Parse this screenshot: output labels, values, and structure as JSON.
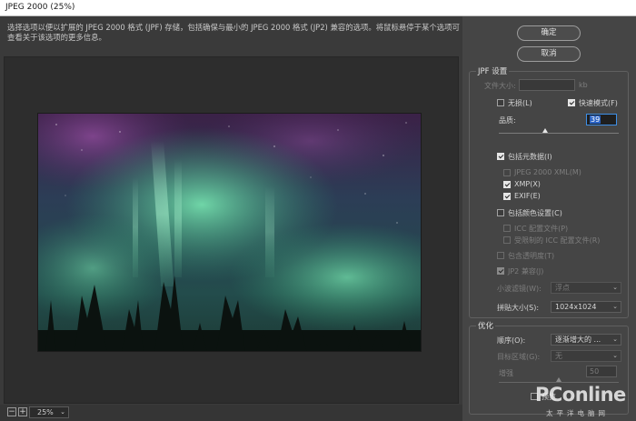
{
  "window": {
    "title": "JPEG 2000 (25%)"
  },
  "description": "选择选项以便以扩展的 JPEG 2000 格式 (JPF) 存储，包括确保与最小的 JPEG 2000 格式 (JP2) 兼容的选项。将鼠标悬停于某个选项可查看关于该选项的更多信息。",
  "zoom": {
    "minus": "−",
    "plus": "+",
    "value": "25%"
  },
  "buttons": {
    "ok": "确定",
    "cancel": "取消"
  },
  "jpf": {
    "group_label": "JPF 设置",
    "file_size_label": "文件大小:",
    "file_size_value": "",
    "file_size_unit": "kb",
    "lossless_label": "无损(L)",
    "lossless_checked": false,
    "fast_mode_label": "快速模式(F)",
    "fast_mode_checked": true,
    "quality_label": "品质:",
    "quality_value": "39",
    "quality_fraction": 0.39,
    "include_metadata_label": "包括元数据(I)",
    "include_metadata_checked": true,
    "jpeg2000_xml_label": "JPEG 2000 XML(M)",
    "jpeg2000_xml_checked": false,
    "xmp_label": "XMP(X)",
    "xmp_checked": true,
    "exif_label": "EXIF(E)",
    "exif_checked": true,
    "include_color_label": "包括颜色设置(C)",
    "include_color_checked": false,
    "icc_profile_label": "ICC 配置文件(P)",
    "restricted_icc_label": "受限制的 ICC 配置文件(R)",
    "include_transparency_label": "包含透明度(T)",
    "jp2_compat_label": "JP2 兼容(J)",
    "jp2_compat_checked": true,
    "wavelet_label": "小波滤镜(W):",
    "wavelet_value": "浮点",
    "tile_label": "拼贴大小(S):",
    "tile_value": "1024x1024"
  },
  "optimization": {
    "group_label": "优化",
    "order_label": "顺序(O):",
    "order_value": "逐渐增大的 ...",
    "roi_label": "目标区域(G):",
    "roi_value": "无",
    "enhance_label": "增强",
    "enhance_value": "50",
    "enhance_fraction": 0.5,
    "preview_label": "预览"
  },
  "watermark": {
    "logo": "PConline",
    "sub": "太平洋电脑网"
  },
  "colors": {
    "accent": "#3d8ee6",
    "aurora_green": "#59d39a",
    "aurora_purple": "#7a3d86"
  }
}
